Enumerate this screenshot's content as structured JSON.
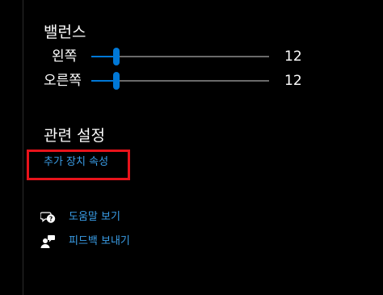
{
  "balance": {
    "title": "밸런스",
    "left": {
      "label": "왼쪽",
      "value": "12",
      "level": 0.14
    },
    "right": {
      "label": "오른쪽",
      "value": "12",
      "level": 0.14
    }
  },
  "related_settings": {
    "title": "관련 설정",
    "device_properties_link": "추가 장치 속성"
  },
  "help": {
    "get_help_label": "도움말 보기",
    "get_help_icon": "chat-bubbles-help-icon",
    "feedback_label": "피드백 보내기",
    "feedback_icon": "person-feedback-icon"
  },
  "colors": {
    "accent": "#0078d7",
    "link": "#3a9ee8",
    "highlight": "#e8131b",
    "background": "#000000"
  }
}
